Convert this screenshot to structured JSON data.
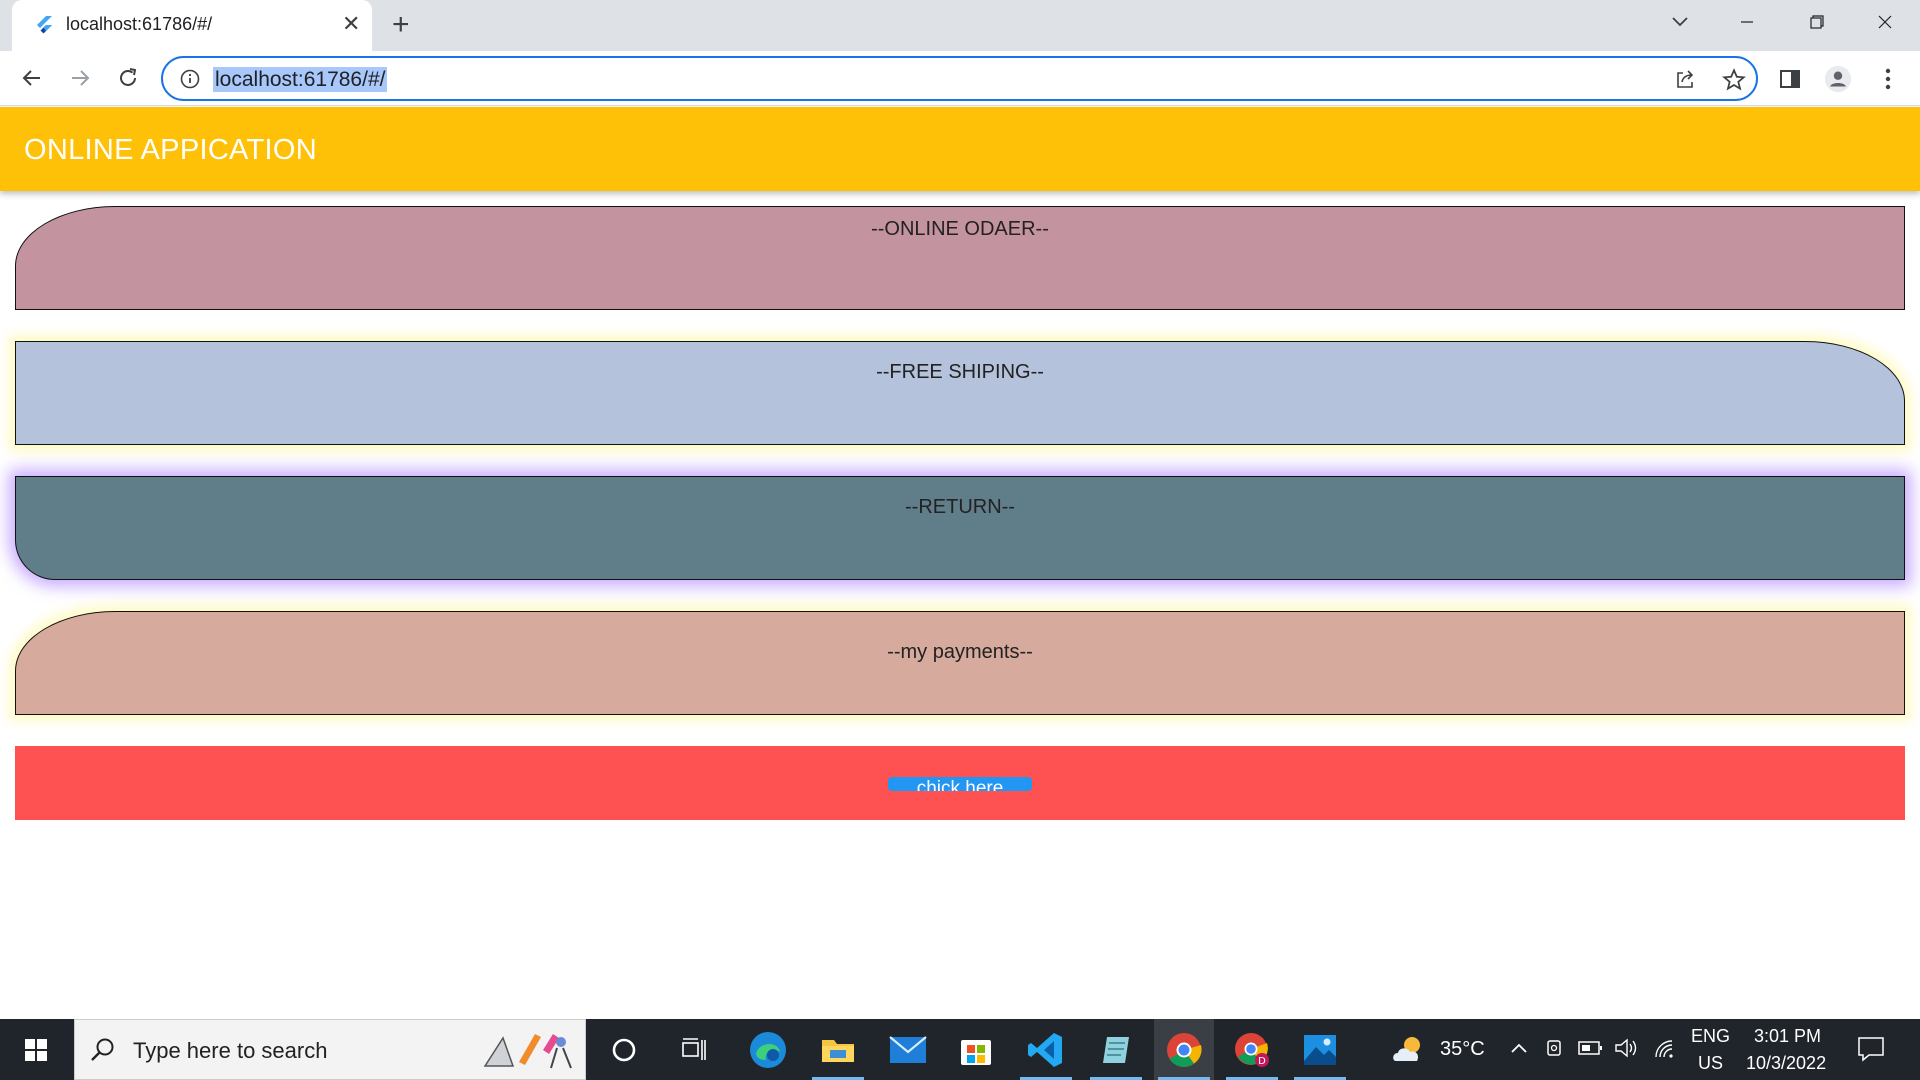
{
  "browser": {
    "tab_title": "localhost:61786/#/",
    "url": "localhost:61786/#/"
  },
  "app": {
    "title": "ONLINE APPICATION",
    "cards": [
      {
        "label": "--ONLINE ODAER--",
        "color": "#c493a0"
      },
      {
        "label": "--FREE SHIPING--",
        "color": "#b4c2dc"
      },
      {
        "label": "--RETURN--",
        "color": "#607d8a"
      },
      {
        "label": "--my payments--",
        "color": "#d6aa9c"
      }
    ],
    "action_button": "chick here",
    "colors": {
      "appbar": "#fec107",
      "action_bar": "#fe5252",
      "button": "#2196f3"
    }
  },
  "taskbar": {
    "search_placeholder": "Type here to search",
    "weather": "35°C",
    "language": "ENG",
    "region": "US",
    "time": "3:01 PM",
    "date": "10/3/2022"
  }
}
